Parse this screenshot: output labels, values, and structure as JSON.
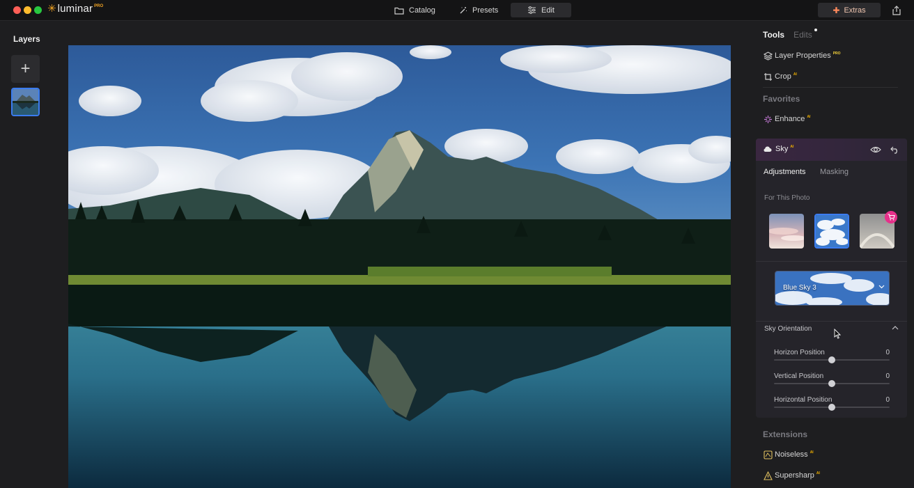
{
  "app": {
    "name": "luminar",
    "badge": "PRO"
  },
  "nav": {
    "catalog": "Catalog",
    "presets": "Presets",
    "edit": "Edit",
    "extras": "Extras"
  },
  "layers": {
    "title": "Layers"
  },
  "panel": {
    "tab_tools": "Tools",
    "tab_edits": "Edits",
    "tools": [
      {
        "label": "Layer Properties",
        "badge": "PRO"
      },
      {
        "label": "Crop",
        "badge": "AI"
      }
    ],
    "favorites_label": "Favorites",
    "favorites": [
      {
        "label": "Enhance",
        "badge": "AI"
      }
    ],
    "sky": {
      "title": "Sky",
      "badge": "AI",
      "subtab_adjustments": "Adjustments",
      "subtab_masking": "Masking",
      "for_this_photo": "For This Photo",
      "selected_sky": "Blue Sky 3",
      "orientation_label": "Sky Orientation",
      "sliders": [
        {
          "label": "Horizon Position",
          "value": "0",
          "level": 0.5
        },
        {
          "label": "Vertical Position",
          "value": "0",
          "level": 0.5
        },
        {
          "label": "Horizontal Position",
          "value": "0",
          "level": 0.5
        }
      ]
    },
    "extensions_label": "Extensions",
    "extensions": [
      {
        "label": "Noiseless",
        "badge": "AI"
      },
      {
        "label": "Supersharp",
        "badge": "AI"
      }
    ]
  },
  "colors": {
    "accent_blue": "#3b7cf0",
    "cart_pink": "#e6308a",
    "logo_orange": "#f5a623"
  }
}
